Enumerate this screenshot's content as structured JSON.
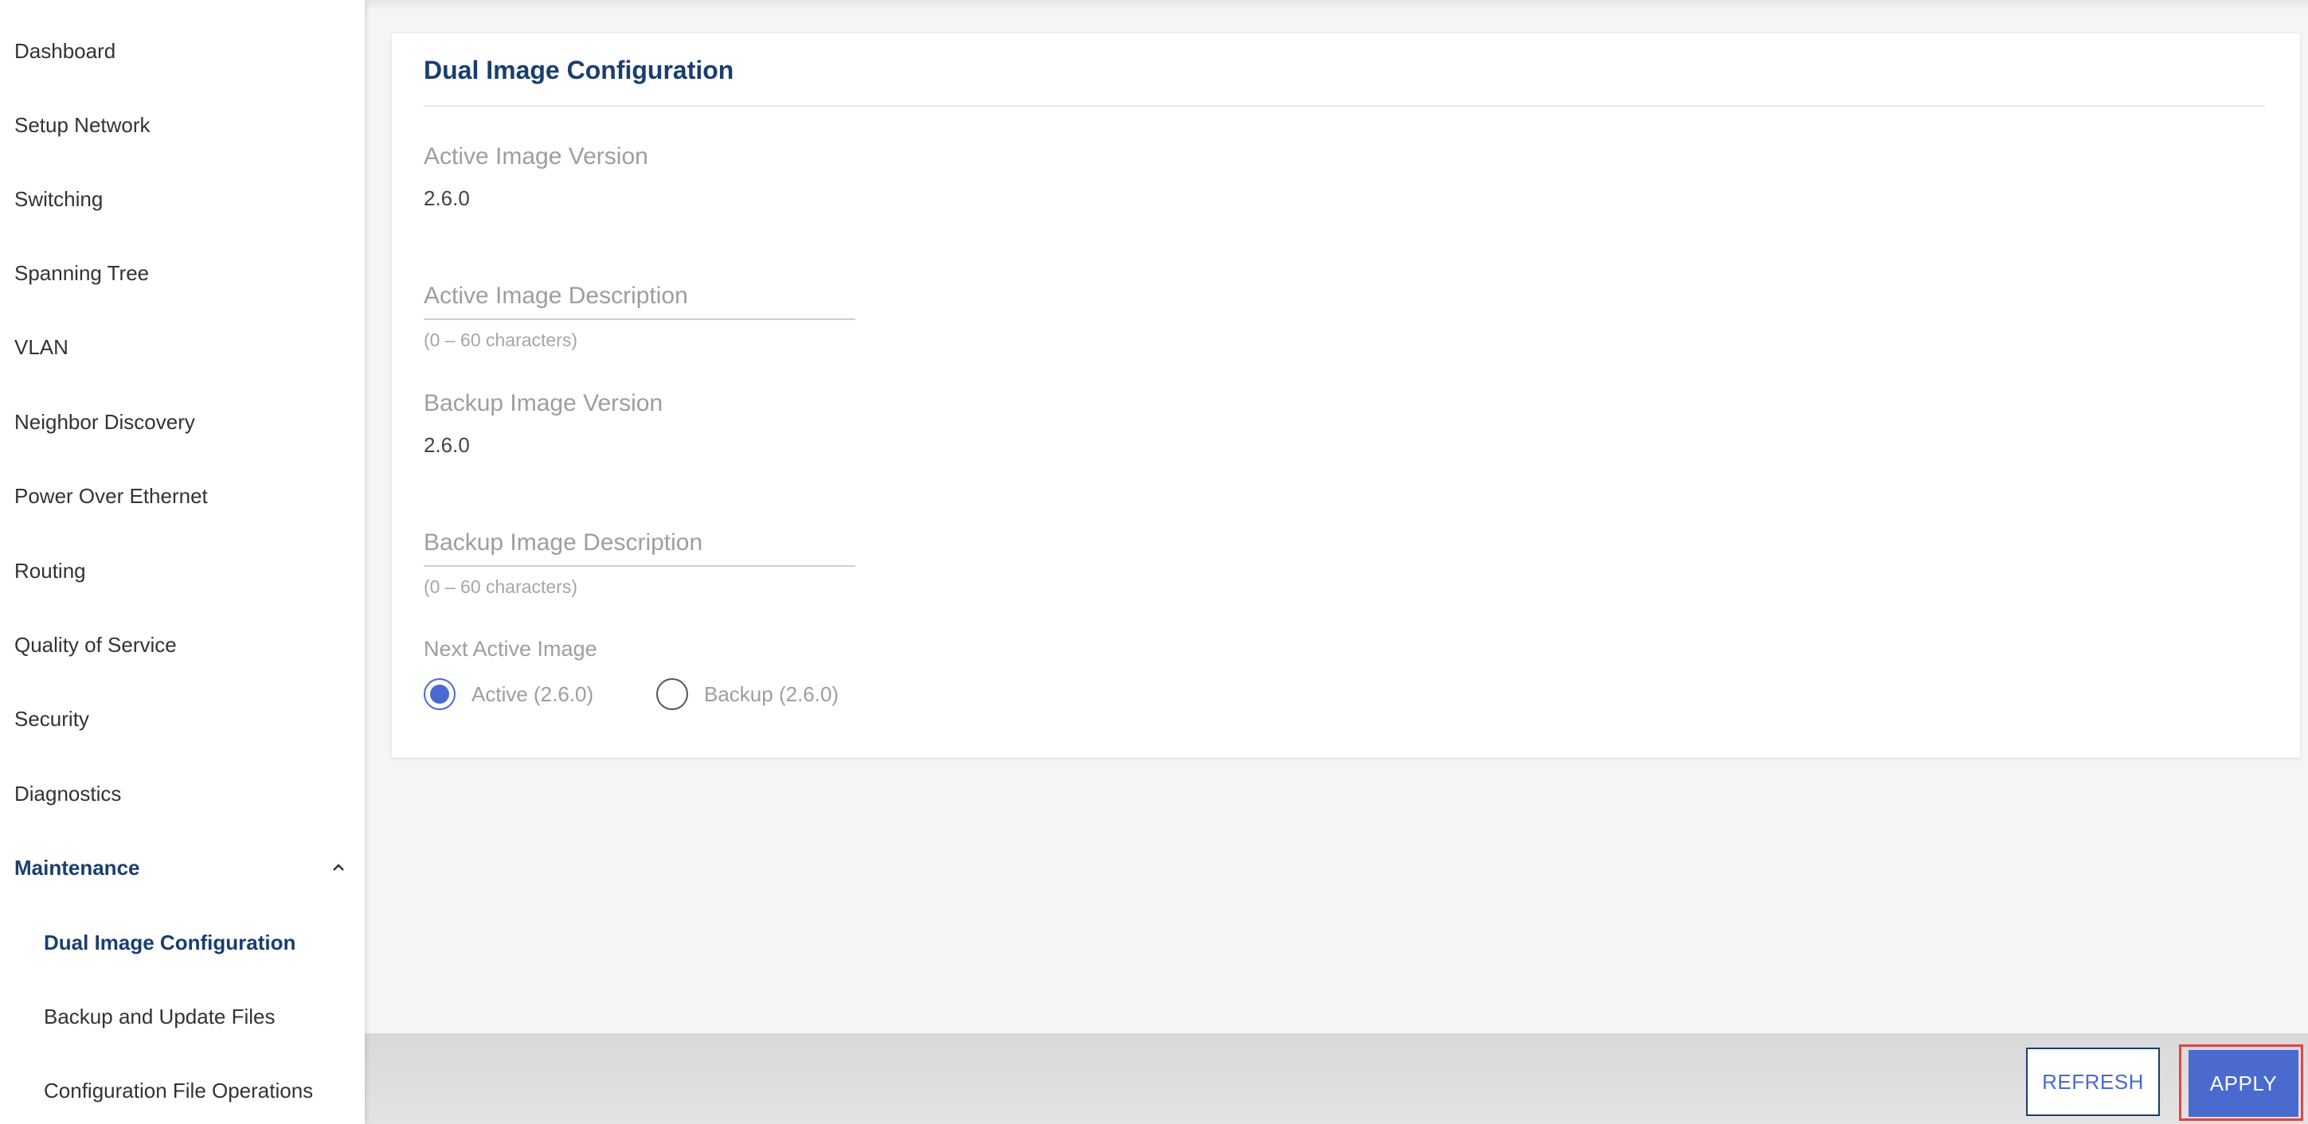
{
  "sidebar": {
    "items": [
      {
        "label": "Dashboard"
      },
      {
        "label": "Setup Network"
      },
      {
        "label": "Switching"
      },
      {
        "label": "Spanning Tree"
      },
      {
        "label": "VLAN"
      },
      {
        "label": "Neighbor Discovery"
      },
      {
        "label": "Power Over Ethernet"
      },
      {
        "label": "Routing"
      },
      {
        "label": "Quality of Service"
      },
      {
        "label": "Security"
      },
      {
        "label": "Diagnostics"
      },
      {
        "label": "Maintenance",
        "expanded": true,
        "icon": "chevron-up-icon"
      }
    ],
    "subitems": [
      {
        "label": "Dual Image Configuration",
        "active": true
      },
      {
        "label": "Backup and Update Files"
      },
      {
        "label": "Configuration File Operations"
      }
    ]
  },
  "card": {
    "title": "Dual Image Configuration",
    "active_version_label": "Active Image Version",
    "active_version_value": "2.6.0",
    "active_desc_placeholder": "Active Image Description",
    "active_desc_value": "",
    "active_desc_hint": "(0 – 60 characters)",
    "backup_version_label": "Backup Image Version",
    "backup_version_value": "2.6.0",
    "backup_desc_placeholder": "Backup Image Description",
    "backup_desc_value": "",
    "backup_desc_hint": "(0 – 60 characters)",
    "next_active_label": "Next Active Image",
    "options": [
      {
        "label": "Active (2.6.0)",
        "selected": true
      },
      {
        "label": "Backup (2.6.0)",
        "selected": false
      }
    ]
  },
  "footer": {
    "refresh_label": "REFRESH",
    "apply_label": "APPLY"
  },
  "colors": {
    "accent": "#4a6ad0",
    "heading": "#1a3e6e",
    "highlight_border": "#e04545"
  }
}
